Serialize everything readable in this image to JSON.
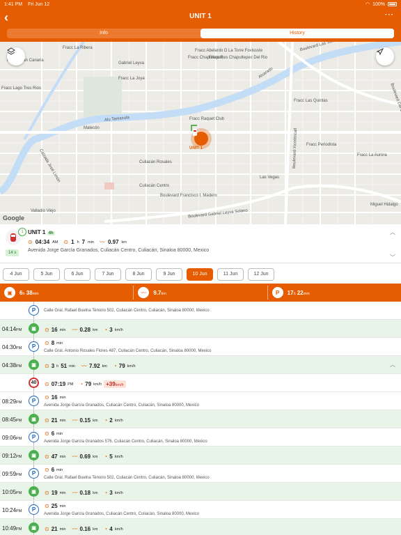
{
  "status_bar": {
    "time": "1:41 PM",
    "date": "Fri Jun 12",
    "battery": "100%"
  },
  "header": {
    "title": "UNIT 1"
  },
  "tabs": [
    {
      "label": "Info",
      "active": false
    },
    {
      "label": "History",
      "active": true
    }
  ],
  "map": {
    "labels": [
      "Fracc La Ribera",
      "Fracc Gran Canaria",
      "Gabriel Leyva",
      "Fracc Chapultepec",
      "Fracc Abelardo D La Torre Fovissste",
      "Fracc Res Chapultepec Del Rio",
      "Boulevard Las Torres",
      "Fracc Lago Tres Rios",
      "Fracc La Joya",
      "Fracc Las Quintas",
      "Alvarado",
      "Alu Tamazula",
      "Malecón",
      "Fracc Raquet Club",
      "Fracc Periodista",
      "Culiacán Rosales",
      "Fracc La Aurora",
      "Las Vegas",
      "Culiacán Centro",
      "Boulevard Francisco I. Madero",
      "Miguel Hidalgo",
      "Valladio Viejo",
      "Boulevard Gabriel Leyva Solano",
      "Calzada José Limón",
      "Boulevard Xicoténcatl",
      "Boulevard Del Ley"
    ],
    "marker_label": "UNIT 1",
    "attribution": "Google",
    "accent": "#e65c00"
  },
  "vehicle": {
    "name": "UNIT 1",
    "badge": "4h",
    "time": "04:34",
    "time_suffix": "AM",
    "duration_h": "1",
    "duration_m": "7",
    "duration_unit": "min",
    "distance": "0.97",
    "distance_unit": "km",
    "address": "Avenida Jorge García Granados, Culiacán Centro, Culiacán, Sinaloa 80000, Mexico",
    "elapsed": "14 s"
  },
  "dates": [
    {
      "label": "4 Jun"
    },
    {
      "label": "5 Jun"
    },
    {
      "label": "6 Jun"
    },
    {
      "label": "7 Jun"
    },
    {
      "label": "8 Jun"
    },
    {
      "label": "9 Jun"
    },
    {
      "label": "10 Jun",
      "selected": true
    },
    {
      "label": "11 Jun"
    },
    {
      "label": "12 Jun"
    }
  ],
  "summary": {
    "driving_h": "6",
    "driving_m": "38",
    "distance": "9.7",
    "parked_h": "17",
    "parked_m": "22"
  },
  "units": {
    "h": "h",
    "min": "min",
    "km": "km",
    "kmh": "km/h",
    "pm": "PM"
  },
  "timeline": [
    {
      "type": "parking",
      "time": "",
      "duration": "",
      "address": "Calle Gral. Rafael Buelna Tenorio 502, Culiacán Centro, Culiacán, Sinaloa 80000, Mexico"
    },
    {
      "type": "drive",
      "time": "04:14",
      "duration": "16",
      "duration_unit": "min",
      "distance": "0.28",
      "speed": "3"
    },
    {
      "type": "parking",
      "time": "04:30",
      "duration": "8",
      "duration_unit": "min",
      "address": "Calle Gral. Antonio Rosales Flores 487, Culiacán Centro, Culiacán, Sinaloa 80000, Mexico"
    },
    {
      "type": "drive",
      "time": "04:38",
      "duration_h": "3",
      "duration": "51",
      "duration_unit": "min",
      "distance": "7.92",
      "speed": "79",
      "expanded": true
    },
    {
      "type": "speeding",
      "limit": "40",
      "at": "07:19",
      "speed": "79",
      "over": "+39"
    },
    {
      "type": "parking",
      "time": "08:29",
      "duration": "16",
      "duration_unit": "min",
      "address": "Avenida Jorge García Granados, Culiacán Centro, Culiacán, Sinaloa 80000, Mexico"
    },
    {
      "type": "drive",
      "time": "08:45",
      "duration": "21",
      "duration_unit": "min",
      "distance": "0.15",
      "speed": "2"
    },
    {
      "type": "parking",
      "time": "09:06",
      "duration": "6",
      "duration_unit": "min",
      "address": "Avenida Jorge García Granados 576, Culiacán Centro, Culiacán, Sinaloa 80000, Mexico"
    },
    {
      "type": "drive",
      "time": "09:12",
      "duration": "47",
      "duration_unit": "min",
      "distance": "0.69",
      "speed": "5"
    },
    {
      "type": "parking",
      "time": "09:59",
      "duration": "6",
      "duration_unit": "min",
      "address": "Calle Gral. Rafael Buelna Tenorio 502, Culiacán Centro, Culiacán, Sinaloa 80000, Mexico"
    },
    {
      "type": "drive",
      "time": "10:05",
      "duration": "19",
      "duration_unit": "min",
      "distance": "0.18",
      "speed": "3"
    },
    {
      "type": "parking",
      "time": "10:24",
      "duration": "25",
      "duration_unit": "min",
      "address": "Avenida Jorge García Granados, Culiacán Centro, Culiacán, Sinaloa 80000, Mexico"
    },
    {
      "type": "drive",
      "time": "10:49",
      "duration": "21",
      "duration_unit": "min",
      "distance": "0.16",
      "speed": "4"
    }
  ]
}
